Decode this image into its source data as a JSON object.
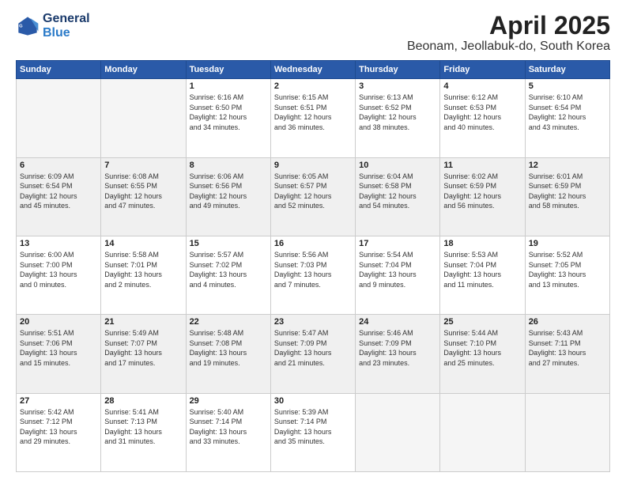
{
  "header": {
    "logo_line1": "General",
    "logo_line2": "Blue",
    "month": "April 2025",
    "location": "Beonam, Jeollabuk-do, South Korea"
  },
  "days_of_week": [
    "Sunday",
    "Monday",
    "Tuesday",
    "Wednesday",
    "Thursday",
    "Friday",
    "Saturday"
  ],
  "weeks": [
    [
      {
        "day": "",
        "info": ""
      },
      {
        "day": "",
        "info": ""
      },
      {
        "day": "1",
        "info": "Sunrise: 6:16 AM\nSunset: 6:50 PM\nDaylight: 12 hours\nand 34 minutes."
      },
      {
        "day": "2",
        "info": "Sunrise: 6:15 AM\nSunset: 6:51 PM\nDaylight: 12 hours\nand 36 minutes."
      },
      {
        "day": "3",
        "info": "Sunrise: 6:13 AM\nSunset: 6:52 PM\nDaylight: 12 hours\nand 38 minutes."
      },
      {
        "day": "4",
        "info": "Sunrise: 6:12 AM\nSunset: 6:53 PM\nDaylight: 12 hours\nand 40 minutes."
      },
      {
        "day": "5",
        "info": "Sunrise: 6:10 AM\nSunset: 6:54 PM\nDaylight: 12 hours\nand 43 minutes."
      }
    ],
    [
      {
        "day": "6",
        "info": "Sunrise: 6:09 AM\nSunset: 6:54 PM\nDaylight: 12 hours\nand 45 minutes."
      },
      {
        "day": "7",
        "info": "Sunrise: 6:08 AM\nSunset: 6:55 PM\nDaylight: 12 hours\nand 47 minutes."
      },
      {
        "day": "8",
        "info": "Sunrise: 6:06 AM\nSunset: 6:56 PM\nDaylight: 12 hours\nand 49 minutes."
      },
      {
        "day": "9",
        "info": "Sunrise: 6:05 AM\nSunset: 6:57 PM\nDaylight: 12 hours\nand 52 minutes."
      },
      {
        "day": "10",
        "info": "Sunrise: 6:04 AM\nSunset: 6:58 PM\nDaylight: 12 hours\nand 54 minutes."
      },
      {
        "day": "11",
        "info": "Sunrise: 6:02 AM\nSunset: 6:59 PM\nDaylight: 12 hours\nand 56 minutes."
      },
      {
        "day": "12",
        "info": "Sunrise: 6:01 AM\nSunset: 6:59 PM\nDaylight: 12 hours\nand 58 minutes."
      }
    ],
    [
      {
        "day": "13",
        "info": "Sunrise: 6:00 AM\nSunset: 7:00 PM\nDaylight: 13 hours\nand 0 minutes."
      },
      {
        "day": "14",
        "info": "Sunrise: 5:58 AM\nSunset: 7:01 PM\nDaylight: 13 hours\nand 2 minutes."
      },
      {
        "day": "15",
        "info": "Sunrise: 5:57 AM\nSunset: 7:02 PM\nDaylight: 13 hours\nand 4 minutes."
      },
      {
        "day": "16",
        "info": "Sunrise: 5:56 AM\nSunset: 7:03 PM\nDaylight: 13 hours\nand 7 minutes."
      },
      {
        "day": "17",
        "info": "Sunrise: 5:54 AM\nSunset: 7:04 PM\nDaylight: 13 hours\nand 9 minutes."
      },
      {
        "day": "18",
        "info": "Sunrise: 5:53 AM\nSunset: 7:04 PM\nDaylight: 13 hours\nand 11 minutes."
      },
      {
        "day": "19",
        "info": "Sunrise: 5:52 AM\nSunset: 7:05 PM\nDaylight: 13 hours\nand 13 minutes."
      }
    ],
    [
      {
        "day": "20",
        "info": "Sunrise: 5:51 AM\nSunset: 7:06 PM\nDaylight: 13 hours\nand 15 minutes."
      },
      {
        "day": "21",
        "info": "Sunrise: 5:49 AM\nSunset: 7:07 PM\nDaylight: 13 hours\nand 17 minutes."
      },
      {
        "day": "22",
        "info": "Sunrise: 5:48 AM\nSunset: 7:08 PM\nDaylight: 13 hours\nand 19 minutes."
      },
      {
        "day": "23",
        "info": "Sunrise: 5:47 AM\nSunset: 7:09 PM\nDaylight: 13 hours\nand 21 minutes."
      },
      {
        "day": "24",
        "info": "Sunrise: 5:46 AM\nSunset: 7:09 PM\nDaylight: 13 hours\nand 23 minutes."
      },
      {
        "day": "25",
        "info": "Sunrise: 5:44 AM\nSunset: 7:10 PM\nDaylight: 13 hours\nand 25 minutes."
      },
      {
        "day": "26",
        "info": "Sunrise: 5:43 AM\nSunset: 7:11 PM\nDaylight: 13 hours\nand 27 minutes."
      }
    ],
    [
      {
        "day": "27",
        "info": "Sunrise: 5:42 AM\nSunset: 7:12 PM\nDaylight: 13 hours\nand 29 minutes."
      },
      {
        "day": "28",
        "info": "Sunrise: 5:41 AM\nSunset: 7:13 PM\nDaylight: 13 hours\nand 31 minutes."
      },
      {
        "day": "29",
        "info": "Sunrise: 5:40 AM\nSunset: 7:14 PM\nDaylight: 13 hours\nand 33 minutes."
      },
      {
        "day": "30",
        "info": "Sunrise: 5:39 AM\nSunset: 7:14 PM\nDaylight: 13 hours\nand 35 minutes."
      },
      {
        "day": "",
        "info": ""
      },
      {
        "day": "",
        "info": ""
      },
      {
        "day": "",
        "info": ""
      }
    ]
  ]
}
